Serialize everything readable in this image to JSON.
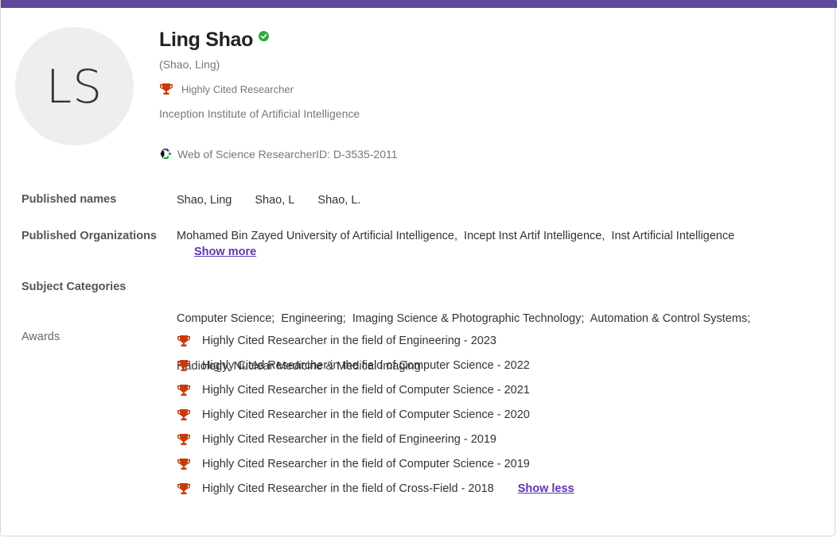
{
  "profile": {
    "initials": "LS",
    "name": "Ling Shao",
    "alias": "(Shao, Ling)",
    "badge_label": "Highly Cited Researcher",
    "institution": "Inception Institute of Artificial Intelligence",
    "researcher_id_text": "Web of Science ResearcherID: D-3535-2011",
    "verified": true
  },
  "colors": {
    "accent_bar": "#5e4897",
    "trophy": "#c63b0d",
    "verified": "#2eaa3f",
    "link": "#5e35b1"
  },
  "sections": {
    "published_names": {
      "label": "Published names",
      "values": [
        "Shao, Ling",
        "Shao, L",
        "Shao, L."
      ]
    },
    "published_organizations": {
      "label": "Published Organizations",
      "text": "Mohamed Bin Zayed University of Artificial Intelligence,  Incept Inst Artif Intelligence,  Inst Artificial Intelligence",
      "show_more_label": "Show more"
    },
    "subject_categories": {
      "label": "Subject Categories",
      "line1": "Computer Science;  Engineering;  Imaging Science & Photographic Technology;  Automation & Control Systems;",
      "line2": "Radiology, Nuclear Medicine & Medical Imaging"
    },
    "awards": {
      "label": "Awards",
      "items": [
        "Highly Cited Researcher in the field of Engineering - 2023",
        "Highly Cited Researcher in the field of Computer Science - 2022",
        "Highly Cited Researcher in the field of Computer Science - 2021",
        "Highly Cited Researcher in the field of Computer Science - 2020",
        "Highly Cited Researcher in the field of Engineering - 2019",
        "Highly Cited Researcher in the field of Computer Science - 2019",
        "Highly Cited Researcher in the field of Cross-Field - 2018"
      ],
      "show_less_label": "Show less"
    }
  }
}
